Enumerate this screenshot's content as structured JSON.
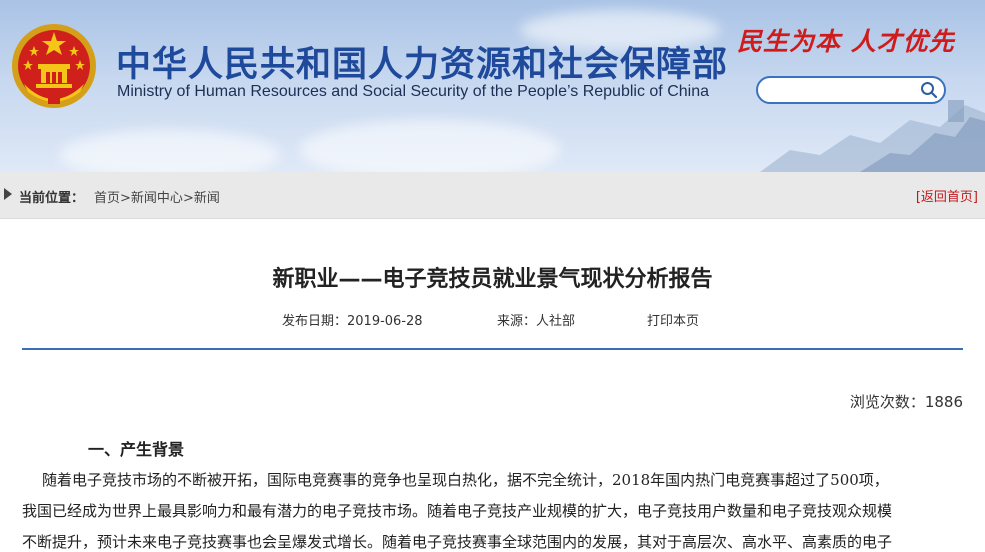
{
  "header": {
    "title_cn": "中华人民共和国人力资源和社会保障部",
    "title_en": "Ministry of Human Resources and Social Security of the People’s Republic of China",
    "slogan": "民生为本 人才优先",
    "search": {
      "placeholder": "",
      "value": ""
    },
    "colors": {
      "brand_blue": "#1f4a9c",
      "slogan_red": "#d01b1b"
    }
  },
  "breadcrumb": {
    "label": "当前位置：",
    "items": [
      "首页",
      "新闻中心",
      "新闻"
    ],
    "separator": ">",
    "back_home": "[返回首页]"
  },
  "article": {
    "title": "新职业——电子竞技员就业景气现状分析报告",
    "date": "发布日期：2019-06-28",
    "source": "来源：人社部",
    "print": "打印本页",
    "views": "浏览次数：1886",
    "section_heading": "一、产生背景",
    "paragraph_lines": [
      "随着电子竞技市场的不断被开拓，国际电竞赛事的竞争也呈现白热化，据不完全统计，2018年国内热门电竞赛事超过了500项，",
      "我国已经成为世界上最具影响力和最有潜力的电子竞技市场。随着电子竞技产业规模的扩大，电子竞技用户数量和电子竞技观众规模",
      "不断提升，预计未来电子竞技赛事也会呈爆发式增长。随着电子竞技赛事全球范围内的发展，其对于高层次、高水平、高素质的电子"
    ]
  }
}
